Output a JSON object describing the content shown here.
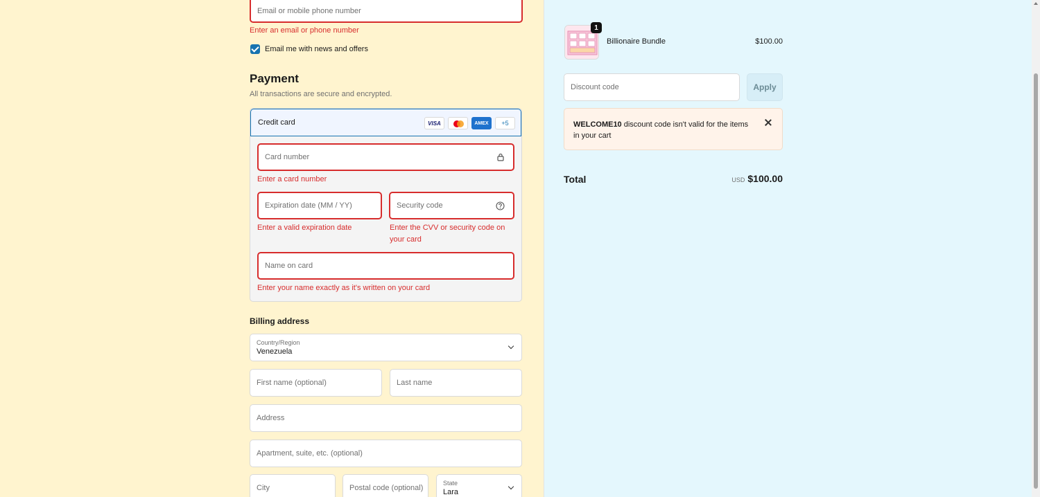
{
  "contact": {
    "email_placeholder": "Email or mobile phone number",
    "email_error": "Enter an email or phone number",
    "newsletter_label": "Email me with news and offers",
    "newsletter_checked": true
  },
  "payment": {
    "title": "Payment",
    "subtitle": "All transactions are secure and encrypted.",
    "method_label": "Credit card",
    "brands": [
      "VISA",
      "AMEX",
      "+5"
    ],
    "card_number_placeholder": "Card number",
    "card_number_error": "Enter a card number",
    "expiry_placeholder": "Expiration date (MM / YY)",
    "expiry_error": "Enter a valid expiration date",
    "cvv_placeholder": "Security code",
    "cvv_error_line1": "Enter the CVV or security code on",
    "cvv_error_line2": "your card",
    "name_placeholder": "Name on card",
    "name_error": "Enter your name exactly as it's written on your card"
  },
  "billing": {
    "title": "Billing address",
    "country_label": "Country/Region",
    "country_value": "Venezuela",
    "first_name_placeholder": "First name (optional)",
    "last_name_placeholder": "Last name",
    "address_placeholder": "Address",
    "apartment_placeholder": "Apartment, suite, etc. (optional)",
    "city_placeholder": "City",
    "postal_placeholder": "Postal code (optional)",
    "state_label": "State",
    "state_value": "Lara"
  },
  "summary": {
    "item_name": "Billionaire Bundle",
    "item_price": "$100.00",
    "item_qty": "1",
    "discount_placeholder": "Discount code",
    "apply_label": "Apply",
    "notice_code": "WELCOME10",
    "notice_line1_rest": " discount code isn't valid for the items",
    "notice_line2": "in your cart",
    "total_label": "Total",
    "total_currency": "USD",
    "total_value": "$100.00"
  },
  "colors": {
    "left_bg": "#fff4cf",
    "right_bg": "#e4f7fd",
    "error": "#d72c2c",
    "accent": "#1773b0"
  }
}
